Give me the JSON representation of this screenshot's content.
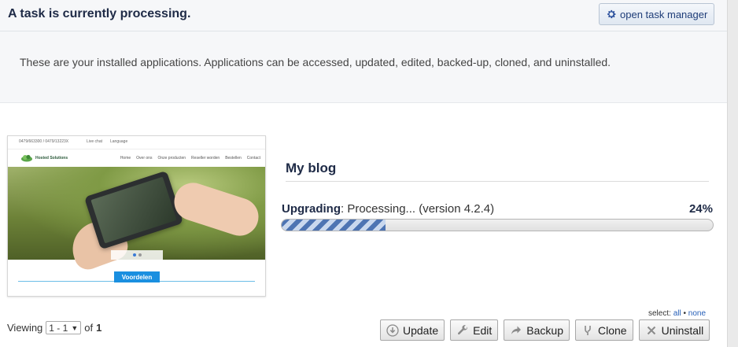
{
  "header": {
    "title": "A task is currently processing.",
    "open_task_manager_label": "open task manager"
  },
  "info": {
    "text": "These are your installed applications. Applications can be accessed, updated, edited, backed-up, cloned, and uninstalled."
  },
  "thumbnail": {
    "phone_text": "0479/663300 / 0479/13223X",
    "live_chat": "Live chat",
    "language": "Language",
    "logo_text": "Hosted Solutions",
    "menu": [
      "Home",
      "Over ons",
      "Onze producten",
      "Reseller worden",
      "Bestellen",
      "Contact"
    ],
    "banner_label": "Voordelen"
  },
  "app": {
    "name": "My blog",
    "status_label": "Upgrading",
    "status_text": ": Processing... (version 4.2.4)",
    "progress_percent_text": "24%",
    "progress_value": 0.24
  },
  "selection": {
    "label": "select:",
    "all": "all",
    "separator": "•",
    "none": "none"
  },
  "pager": {
    "viewing_label": "Viewing",
    "range_value": "1 - 1",
    "of_label": "of",
    "total": "1"
  },
  "actions": {
    "update": "Update",
    "edit": "Edit",
    "backup": "Backup",
    "clone": "Clone",
    "uninstall": "Uninstall"
  },
  "colors": {
    "accent": "#1e2a46",
    "link": "#2760b8",
    "progress": "#4d74b3",
    "banner": "#1a8fe0"
  },
  "icons": {
    "gear": "gear-icon",
    "update": "download-circle-icon",
    "edit": "wrench-icon",
    "backup": "share-arrow-icon",
    "clone": "fork-icon",
    "uninstall": "close-icon"
  }
}
